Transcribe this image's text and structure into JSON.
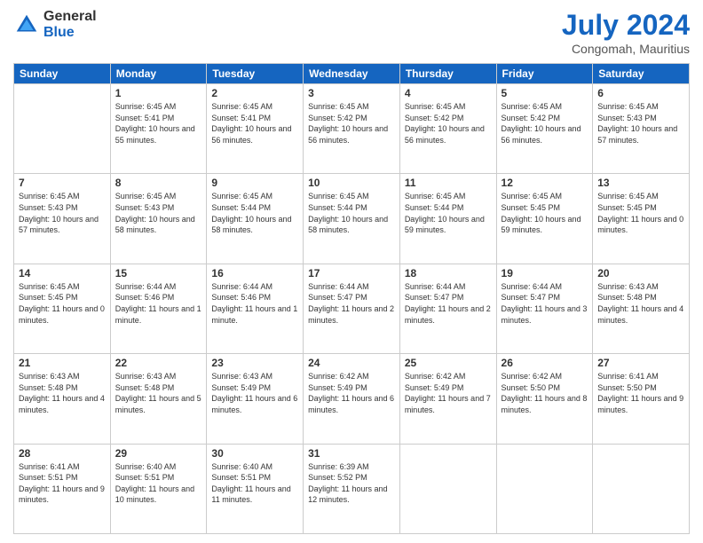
{
  "header": {
    "logo_general": "General",
    "logo_blue": "Blue",
    "month_year": "July 2024",
    "location": "Congomah, Mauritius"
  },
  "weekdays": [
    "Sunday",
    "Monday",
    "Tuesday",
    "Wednesday",
    "Thursday",
    "Friday",
    "Saturday"
  ],
  "weeks": [
    [
      {
        "day": "",
        "sunrise": "",
        "sunset": "",
        "daylight": ""
      },
      {
        "day": "1",
        "sunrise": "Sunrise: 6:45 AM",
        "sunset": "Sunset: 5:41 PM",
        "daylight": "Daylight: 10 hours and 55 minutes."
      },
      {
        "day": "2",
        "sunrise": "Sunrise: 6:45 AM",
        "sunset": "Sunset: 5:41 PM",
        "daylight": "Daylight: 10 hours and 56 minutes."
      },
      {
        "day": "3",
        "sunrise": "Sunrise: 6:45 AM",
        "sunset": "Sunset: 5:42 PM",
        "daylight": "Daylight: 10 hours and 56 minutes."
      },
      {
        "day": "4",
        "sunrise": "Sunrise: 6:45 AM",
        "sunset": "Sunset: 5:42 PM",
        "daylight": "Daylight: 10 hours and 56 minutes."
      },
      {
        "day": "5",
        "sunrise": "Sunrise: 6:45 AM",
        "sunset": "Sunset: 5:42 PM",
        "daylight": "Daylight: 10 hours and 56 minutes."
      },
      {
        "day": "6",
        "sunrise": "Sunrise: 6:45 AM",
        "sunset": "Sunset: 5:43 PM",
        "daylight": "Daylight: 10 hours and 57 minutes."
      }
    ],
    [
      {
        "day": "7",
        "sunrise": "Sunrise: 6:45 AM",
        "sunset": "Sunset: 5:43 PM",
        "daylight": "Daylight: 10 hours and 57 minutes."
      },
      {
        "day": "8",
        "sunrise": "Sunrise: 6:45 AM",
        "sunset": "Sunset: 5:43 PM",
        "daylight": "Daylight: 10 hours and 58 minutes."
      },
      {
        "day": "9",
        "sunrise": "Sunrise: 6:45 AM",
        "sunset": "Sunset: 5:44 PM",
        "daylight": "Daylight: 10 hours and 58 minutes."
      },
      {
        "day": "10",
        "sunrise": "Sunrise: 6:45 AM",
        "sunset": "Sunset: 5:44 PM",
        "daylight": "Daylight: 10 hours and 58 minutes."
      },
      {
        "day": "11",
        "sunrise": "Sunrise: 6:45 AM",
        "sunset": "Sunset: 5:44 PM",
        "daylight": "Daylight: 10 hours and 59 minutes."
      },
      {
        "day": "12",
        "sunrise": "Sunrise: 6:45 AM",
        "sunset": "Sunset: 5:45 PM",
        "daylight": "Daylight: 10 hours and 59 minutes."
      },
      {
        "day": "13",
        "sunrise": "Sunrise: 6:45 AM",
        "sunset": "Sunset: 5:45 PM",
        "daylight": "Daylight: 11 hours and 0 minutes."
      }
    ],
    [
      {
        "day": "14",
        "sunrise": "Sunrise: 6:45 AM",
        "sunset": "Sunset: 5:45 PM",
        "daylight": "Daylight: 11 hours and 0 minutes."
      },
      {
        "day": "15",
        "sunrise": "Sunrise: 6:44 AM",
        "sunset": "Sunset: 5:46 PM",
        "daylight": "Daylight: 11 hours and 1 minute."
      },
      {
        "day": "16",
        "sunrise": "Sunrise: 6:44 AM",
        "sunset": "Sunset: 5:46 PM",
        "daylight": "Daylight: 11 hours and 1 minute."
      },
      {
        "day": "17",
        "sunrise": "Sunrise: 6:44 AM",
        "sunset": "Sunset: 5:47 PM",
        "daylight": "Daylight: 11 hours and 2 minutes."
      },
      {
        "day": "18",
        "sunrise": "Sunrise: 6:44 AM",
        "sunset": "Sunset: 5:47 PM",
        "daylight": "Daylight: 11 hours and 2 minutes."
      },
      {
        "day": "19",
        "sunrise": "Sunrise: 6:44 AM",
        "sunset": "Sunset: 5:47 PM",
        "daylight": "Daylight: 11 hours and 3 minutes."
      },
      {
        "day": "20",
        "sunrise": "Sunrise: 6:43 AM",
        "sunset": "Sunset: 5:48 PM",
        "daylight": "Daylight: 11 hours and 4 minutes."
      }
    ],
    [
      {
        "day": "21",
        "sunrise": "Sunrise: 6:43 AM",
        "sunset": "Sunset: 5:48 PM",
        "daylight": "Daylight: 11 hours and 4 minutes."
      },
      {
        "day": "22",
        "sunrise": "Sunrise: 6:43 AM",
        "sunset": "Sunset: 5:48 PM",
        "daylight": "Daylight: 11 hours and 5 minutes."
      },
      {
        "day": "23",
        "sunrise": "Sunrise: 6:43 AM",
        "sunset": "Sunset: 5:49 PM",
        "daylight": "Daylight: 11 hours and 6 minutes."
      },
      {
        "day": "24",
        "sunrise": "Sunrise: 6:42 AM",
        "sunset": "Sunset: 5:49 PM",
        "daylight": "Daylight: 11 hours and 6 minutes."
      },
      {
        "day": "25",
        "sunrise": "Sunrise: 6:42 AM",
        "sunset": "Sunset: 5:49 PM",
        "daylight": "Daylight: 11 hours and 7 minutes."
      },
      {
        "day": "26",
        "sunrise": "Sunrise: 6:42 AM",
        "sunset": "Sunset: 5:50 PM",
        "daylight": "Daylight: 11 hours and 8 minutes."
      },
      {
        "day": "27",
        "sunrise": "Sunrise: 6:41 AM",
        "sunset": "Sunset: 5:50 PM",
        "daylight": "Daylight: 11 hours and 9 minutes."
      }
    ],
    [
      {
        "day": "28",
        "sunrise": "Sunrise: 6:41 AM",
        "sunset": "Sunset: 5:51 PM",
        "daylight": "Daylight: 11 hours and 9 minutes."
      },
      {
        "day": "29",
        "sunrise": "Sunrise: 6:40 AM",
        "sunset": "Sunset: 5:51 PM",
        "daylight": "Daylight: 11 hours and 10 minutes."
      },
      {
        "day": "30",
        "sunrise": "Sunrise: 6:40 AM",
        "sunset": "Sunset: 5:51 PM",
        "daylight": "Daylight: 11 hours and 11 minutes."
      },
      {
        "day": "31",
        "sunrise": "Sunrise: 6:39 AM",
        "sunset": "Sunset: 5:52 PM",
        "daylight": "Daylight: 11 hours and 12 minutes."
      },
      {
        "day": "",
        "sunrise": "",
        "sunset": "",
        "daylight": ""
      },
      {
        "day": "",
        "sunrise": "",
        "sunset": "",
        "daylight": ""
      },
      {
        "day": "",
        "sunrise": "",
        "sunset": "",
        "daylight": ""
      }
    ]
  ]
}
